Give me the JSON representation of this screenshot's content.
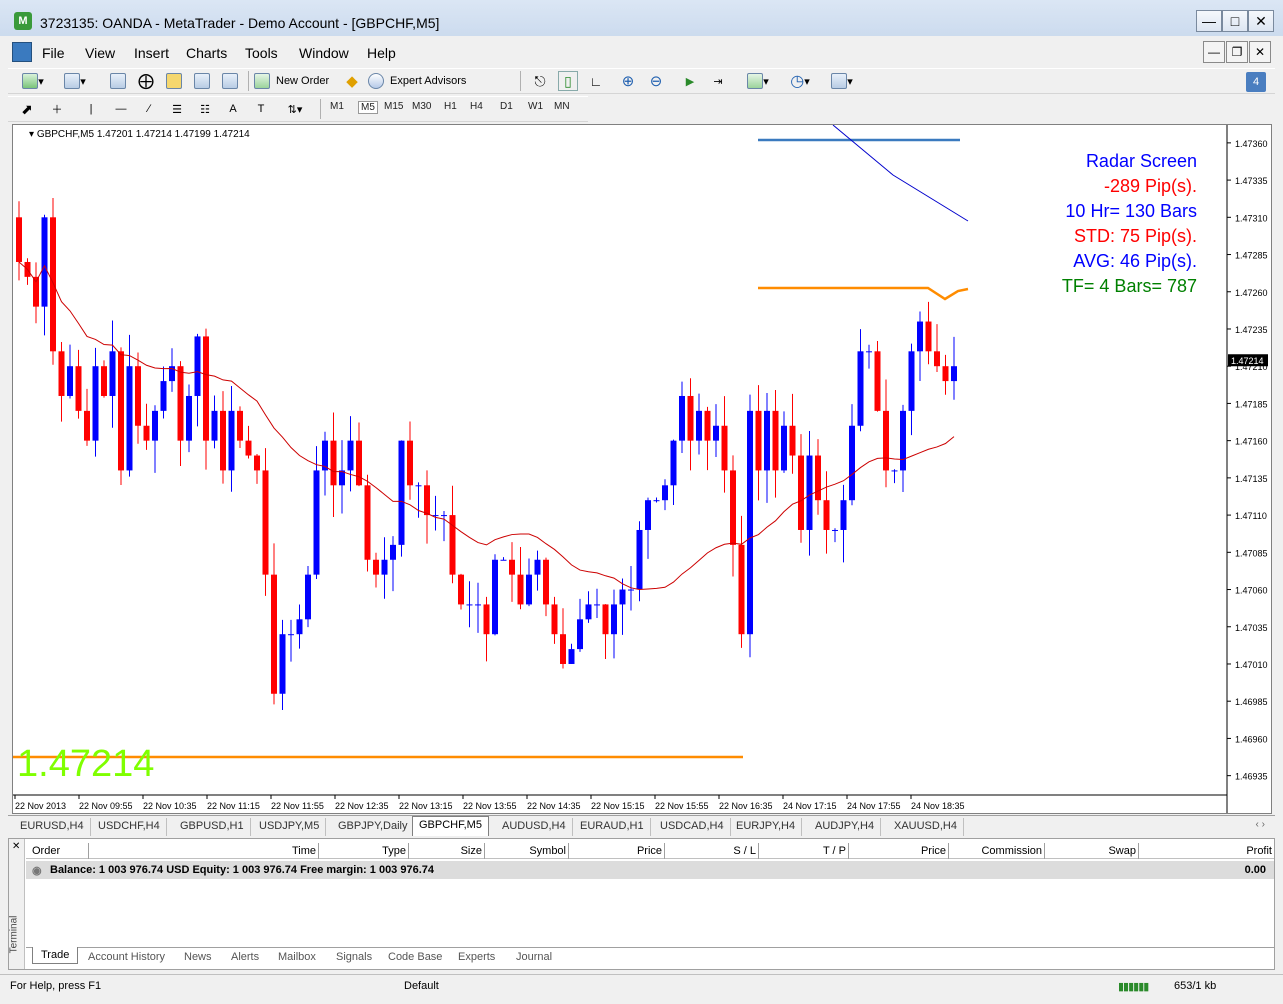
{
  "window": {
    "title": "3723135: OANDA - MetaTrader - Demo Account - [GBPCHF,M5]"
  },
  "menu": [
    "File",
    "View",
    "Insert",
    "Charts",
    "Tools",
    "Window",
    "Help"
  ],
  "toolbar": {
    "new_order": "New Order",
    "expert_advisors": "Expert Advisors"
  },
  "timeframes": [
    "M1",
    "M5",
    "M15",
    "M30",
    "H1",
    "H4",
    "D1",
    "W1",
    "MN"
  ],
  "chart": {
    "header": "GBPCHF,M5  1.47201 1.47214 1.47199 1.47214",
    "big_price": "1.47214",
    "current_price_label": "1.47214",
    "radar": [
      {
        "text": "Radar Screen",
        "color": "#0000ff"
      },
      {
        "text": "-289 Pip(s).",
        "color": "#ff0000"
      },
      {
        "text": "10 Hr= 130 Bars",
        "color": "#0000ff"
      },
      {
        "text": "STD: 75 Pip(s).",
        "color": "#ff0000"
      },
      {
        "text": "AVG: 46 Pip(s).",
        "color": "#0000ff"
      },
      {
        "text": "TF= 4 Bars= 787",
        "color": "#008000"
      }
    ],
    "price_labels": [
      "1.47360",
      "1.47335",
      "1.47310",
      "1.47285",
      "1.47260",
      "1.47235",
      "1.47210",
      "1.47185",
      "1.47160",
      "1.47135",
      "1.47110",
      "1.47085",
      "1.47060",
      "1.47035",
      "1.47010",
      "1.46985",
      "1.46960",
      "1.46935"
    ],
    "time_labels": [
      "22 Nov 2013",
      "22 Nov 09:55",
      "22 Nov 10:35",
      "22 Nov 11:15",
      "22 Nov 11:55",
      "22 Nov 12:35",
      "22 Nov 13:15",
      "22 Nov 13:55",
      "22 Nov 14:35",
      "22 Nov 15:15",
      "22 Nov 15:55",
      "22 Nov 16:35",
      "24 Nov 17:15",
      "24 Nov 17:55",
      "24 Nov 18:35"
    ],
    "colors": {
      "bull": "#0000ff",
      "bear": "#ff0000",
      "ma": "#cc0000",
      "level": "#ff8c00"
    }
  },
  "chart_data": {
    "type": "candlestick",
    "symbol": "GBPCHF",
    "timeframe": "M5",
    "ylim": [
      1.4692,
      1.4737
    ],
    "closes": [
      1.4728,
      1.4727,
      1.4725,
      1.4731,
      1.4722,
      1.4719,
      1.4721,
      1.4718,
      1.4716,
      1.4721,
      1.4719,
      1.4722,
      1.4714,
      1.4721,
      1.4717,
      1.4716,
      1.4718,
      1.472,
      1.4721,
      1.4716,
      1.4719,
      1.4723,
      1.4716,
      1.4718,
      1.4714,
      1.4718,
      1.4716,
      1.4715,
      1.4714,
      1.4707,
      1.4699,
      1.4703,
      1.4703,
      1.4704,
      1.4707,
      1.4714,
      1.4716,
      1.4713,
      1.4714,
      1.4716,
      1.4713,
      1.4708,
      1.4707,
      1.4708,
      1.4709,
      1.4716,
      1.4713,
      1.4713,
      1.4711,
      1.4711,
      1.4711,
      1.4707,
      1.4705,
      1.4705,
      1.4705,
      1.4703,
      1.4708,
      1.4708,
      1.4707,
      1.4705,
      1.4707,
      1.4708,
      1.4705,
      1.4703,
      1.4701,
      1.4702,
      1.4704,
      1.4705,
      1.4705,
      1.4703,
      1.4705,
      1.4706,
      1.4706,
      1.471,
      1.4712,
      1.4712,
      1.4713,
      1.4716,
      1.4719,
      1.4716,
      1.4718,
      1.4716,
      1.4717,
      1.4714,
      1.4709,
      1.4703,
      1.4718,
      1.4714,
      1.4718,
      1.4714,
      1.4717,
      1.4715,
      1.471,
      1.4715,
      1.4712,
      1.471,
      1.471,
      1.4712,
      1.4717,
      1.4722,
      1.4722,
      1.4718,
      1.4714,
      1.4714,
      1.4718,
      1.4722,
      1.4724,
      1.4722,
      1.4721,
      1.472,
      1.4721
    ]
  },
  "symbol_tabs": [
    "EURUSD,H4",
    "USDCHF,H4",
    "GBPUSD,H1",
    "USDJPY,M5",
    "GBPJPY,Daily",
    "GBPCHF,M5",
    "AUDUSD,H4",
    "EURAUD,H1",
    "USDCAD,H4",
    "EURJPY,H4",
    "AUDJPY,H4",
    "XAUUSD,H4"
  ],
  "terminal": {
    "side_label": "Terminal",
    "columns": [
      "Order",
      "Time",
      "Type",
      "Size",
      "Symbol",
      "Price",
      "S / L",
      "T / P",
      "Price",
      "Commission",
      "Swap",
      "Profit"
    ],
    "balance_text": "Balance: 1 003 976.74 USD  Equity: 1 003 976.74  Free margin: 1 003 976.74",
    "profit": "0.00",
    "tabs": [
      "Trade",
      "Account History",
      "News",
      "Alerts",
      "Mailbox",
      "Signals",
      "Code Base",
      "Experts",
      "Journal"
    ]
  },
  "status": {
    "help": "For Help, press F1",
    "profile": "Default",
    "traffic": "653/1 kb"
  }
}
